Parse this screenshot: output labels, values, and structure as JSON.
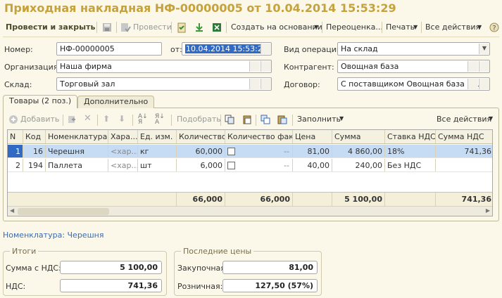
{
  "window": {
    "title": "Приходная накладная НФ-00000005 от 10.04.2014 15:53:29"
  },
  "toolbar": {
    "post_close": "Провести и закрыть",
    "post": "Провести",
    "create_based": "Создать на основании",
    "reprice": "Переоценка...",
    "print": "Печать",
    "all_actions": "Все действия"
  },
  "form": {
    "number_label": "Номер:",
    "number_value": "НФ-00000005",
    "date_label": "от:",
    "date_value": "10.04.2014 15:53:29",
    "operation_label": "Вид операции:",
    "operation_value": "На склад",
    "org_label": "Организация:",
    "org_value": "Наша фирма",
    "contractor_label": "Контрагент:",
    "contractor_value": "Овощная база",
    "warehouse_label": "Склад:",
    "warehouse_value": "Торговый зал",
    "contract_label": "Договор:",
    "contract_value": "С поставщиком Овощная база (RUB), ..."
  },
  "tabs": [
    {
      "label": "Товары (2 поз.)"
    },
    {
      "label": "Дополнительно"
    }
  ],
  "table_toolbar": {
    "add": "Добавить",
    "pick": "Подобрать",
    "fill": "Заполнить",
    "all_actions": "Все действия"
  },
  "table": {
    "headers": [
      "N",
      "Код",
      "Номенклатура",
      "Хара...",
      "Ед. изм.",
      "Количество",
      "Количество факт",
      "Цена",
      "Сумма",
      "Ставка НДС",
      "Сумма НДС"
    ],
    "rows": [
      {
        "n": "1",
        "code": "16",
        "name": "Черешня",
        "char": "<хар...",
        "unit": "кг",
        "qty": "60,000",
        "fact": "--",
        "price": "81,00",
        "sum": "4 860,00",
        "vat_rate": "18%",
        "vat_sum": "741,36"
      },
      {
        "n": "2",
        "code": "194",
        "name": "Паллета",
        "char": "<хар...",
        "unit": "шт",
        "qty": "6,000",
        "fact": "--",
        "price": "40,00",
        "sum": "240,00",
        "vat_rate": "Без НДС",
        "vat_sum": ""
      }
    ],
    "totals": {
      "qty": "66,000",
      "fact": "66,000",
      "sum": "5 100,00",
      "vat_sum": "741,36"
    }
  },
  "nomenclature_link": "Номенклатура: Черешня",
  "totals_box": {
    "title": "Итоги",
    "sum_label": "Сумма с НДС:",
    "sum_value": "5 100,00",
    "vat_label": "НДС:",
    "vat_value": "741,36"
  },
  "prices_box": {
    "title": "Последние цены",
    "purchase_label": "Закупочная:",
    "purchase_value": "81,00",
    "retail_label": "Розничная:",
    "retail_value": "127,50 (57%)"
  },
  "colors": {
    "title": "#c5a23c",
    "background": "#fbf8e9",
    "selection": "#316ac5",
    "row_selected": "#c6dcf4"
  }
}
